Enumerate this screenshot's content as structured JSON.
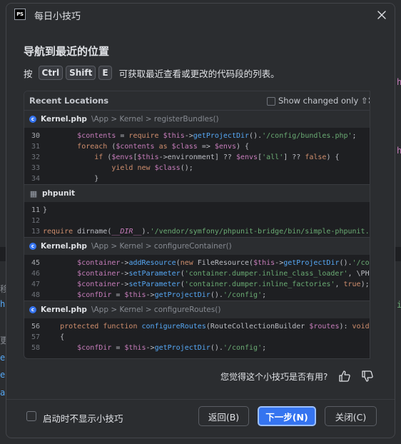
{
  "window": {
    "app_icon_text": "PS",
    "title": "每日小技巧"
  },
  "tip": {
    "title": "导航到最近的位置",
    "text_before": "按",
    "keys": [
      "Ctrl",
      "Shift",
      "E"
    ],
    "text_after": "可获取最近查看或更改的代码段的列表。"
  },
  "preview": {
    "header_title": "Recent Locations",
    "show_changed_label": "Show changed only ⇧⌘",
    "sections": [
      {
        "file": "Kernel.php",
        "icon": "php-class-icon",
        "crumb": "\\App > Kernel > registerBundles()",
        "lines": [
          {
            "n": "30",
            "code": "        $contents = require $this->getProjectDir().'/config/bundles.php';"
          },
          {
            "n": "31",
            "code": "        foreach ($contents as $class => $envs) {"
          },
          {
            "n": "32",
            "code": "            if ($envs[$this->environment] ?? $envs['all'] ?? false) {"
          },
          {
            "n": "33",
            "code": "                yield new $class();"
          },
          {
            "n": "34",
            "code": "            }"
          }
        ]
      },
      {
        "file": "phpunit",
        "icon": "file-grid-icon",
        "crumb": "",
        "lines": [
          {
            "n": "11",
            "code": "}"
          },
          {
            "n": "12",
            "code": ""
          },
          {
            "n": "13",
            "code": "require dirname(__DIR__).'/vendor/symfony/phpunit-bridge/bin/simple-phpunit.php"
          }
        ]
      },
      {
        "file": "Kernel.php",
        "icon": "php-class-icon",
        "crumb": "\\App > Kernel > configureContainer()",
        "lines": [
          {
            "n": "45",
            "code": "        $container->addResource(new FileResource($this->getProjectDir().'/confi"
          },
          {
            "n": "46",
            "code": "        $container->setParameter('container.dumper.inline_class_loader', \\PHP_VE"
          },
          {
            "n": "47",
            "code": "        $container->setParameter('container.dumper.inline_factories', true);"
          },
          {
            "n": "48",
            "code": "        $confDir = $this->getProjectDir().'/config';"
          }
        ]
      },
      {
        "file": "Kernel.php",
        "icon": "php-class-icon",
        "crumb": "\\App > Kernel > configureRoutes()",
        "lines": [
          {
            "n": "56",
            "code": "    protected function configureRoutes(RouteCollectionBuilder $routes): void"
          },
          {
            "n": "57",
            "code": "    {"
          },
          {
            "n": "58",
            "code": "        $confDir = $this->getProjectDir().'/config';"
          }
        ]
      }
    ]
  },
  "feedback": {
    "question": "您觉得这个小技巧是否有用?"
  },
  "footer": {
    "dont_show_label": "启动时不显示小技巧",
    "back_label": "返回(B)",
    "next_label": "下一步(N)",
    "close_label": "关闭(C)"
  },
  "colors": {
    "accent": "#3574f0",
    "dialog_bg": "#2b2d30",
    "editor_bg": "#1e1f22"
  }
}
